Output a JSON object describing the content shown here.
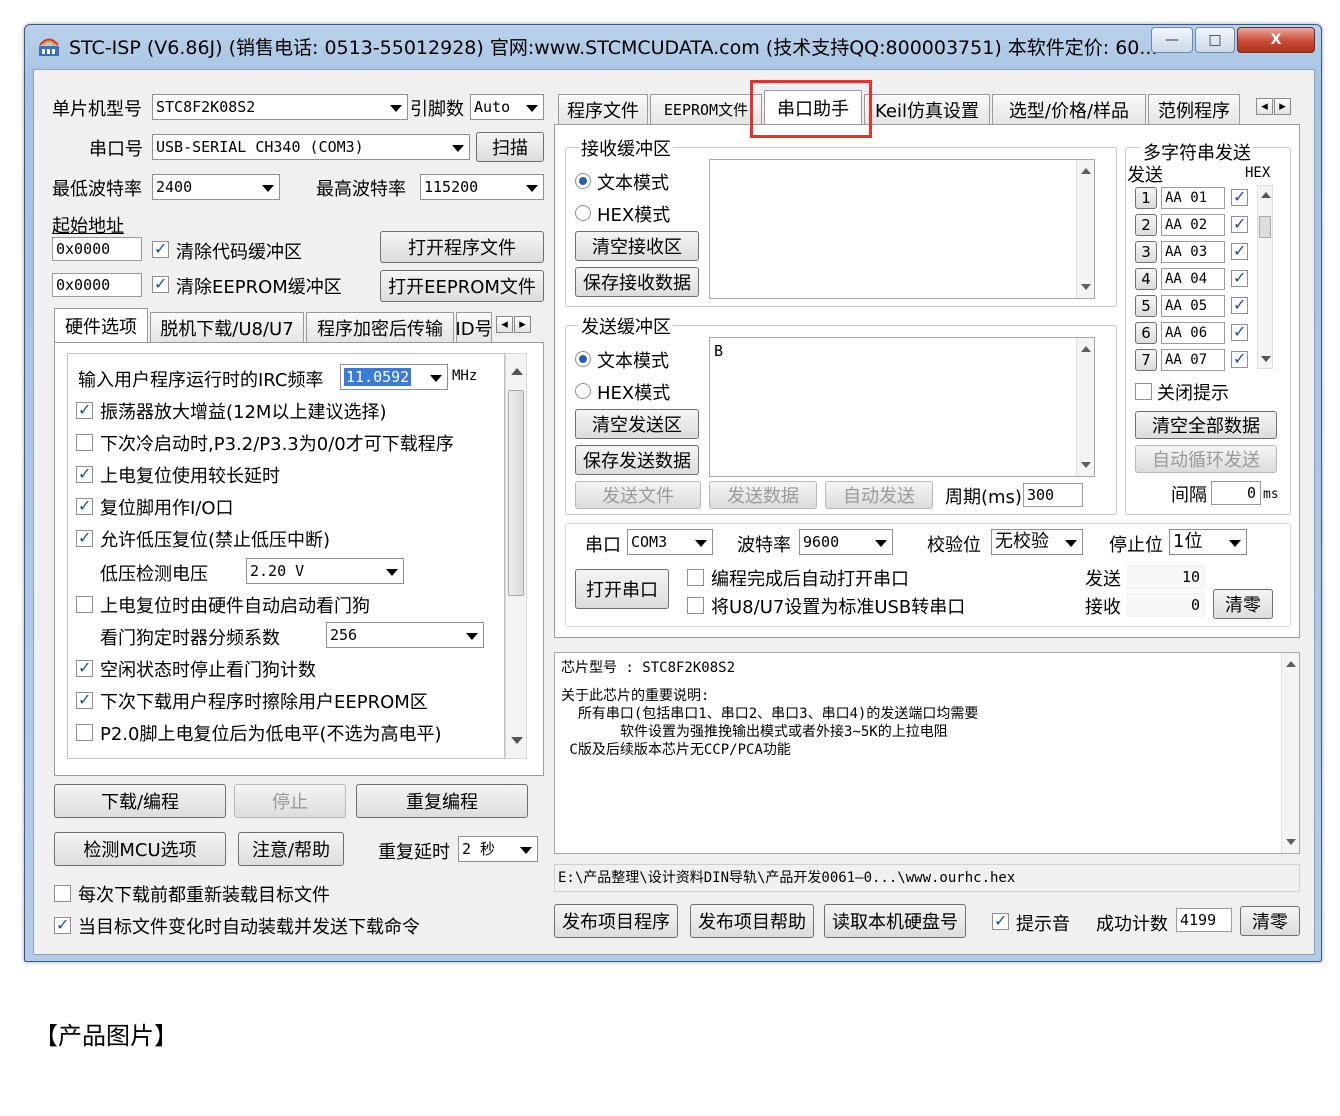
{
  "window": {
    "title": "STC-ISP (V6.86J) (销售电话: 0513-55012928) 官网:www.STCMCUDATA.com  (技术支持QQ:800003751) 本软件定价: 60...",
    "min_glyph": "—",
    "max_glyph": "□",
    "close_glyph": "X"
  },
  "left": {
    "mcu_type_label": "单片机型号",
    "mcu_type_value": "STC8F2K08S2",
    "pins_label": "引脚数",
    "pins_value": "Auto",
    "port_label": "串口号",
    "port_value": "USB-SERIAL CH340 (COM3)",
    "scan_button": "扫描",
    "min_baud_label": "最低波特率",
    "min_baud_value": "2400",
    "max_baud_label": "最高波特率",
    "max_baud_value": "115200",
    "start_addr_label": "起始地址",
    "addr1": "0x0000",
    "clear_code_label": "清除代码缓冲区",
    "open_prog_button": "打开程序文件",
    "addr2": "0x0000",
    "clear_eeprom_label": "清除EEPROM缓冲区",
    "open_eeprom_button": "打开EEPROM文件",
    "tabs": [
      "硬件选项",
      "脱机下载/U8/U7",
      "程序加密后传输",
      "ID号"
    ],
    "options": {
      "irc_label": "输入用户程序运行时的IRC频率",
      "irc_value": "11.0592",
      "irc_unit": "MHz",
      "items": [
        {
          "label": "振荡器放大增益(12M以上建议选择)",
          "checked": true
        },
        {
          "label": "下次冷启动时,P3.2/P3.3为0/0才可下载程序",
          "checked": false
        },
        {
          "label": "上电复位使用较长延时",
          "checked": true
        },
        {
          "label": "复位脚用作I/O口",
          "checked": true
        },
        {
          "label": "允许低压复位(禁止低压中断)",
          "checked": true
        }
      ],
      "lv_label": "低压检测电压",
      "lv_value": "2.20 V",
      "wdt_item": {
        "label": "上电复位时由硬件自动启动看门狗",
        "checked": false
      },
      "wdt_div_label": "看门狗定时器分频系数",
      "wdt_div_value": "256",
      "items2": [
        {
          "label": "空闲状态时停止看门狗计数",
          "checked": true
        },
        {
          "label": "下次下载用户程序时擦除用户EEPROM区",
          "checked": true
        },
        {
          "label": "P2.0脚上电复位后为低电平(不选为高电平)",
          "checked": false
        }
      ]
    },
    "download_button": "下载/编程",
    "stop_button": "停止",
    "reprogram_button": "重复编程",
    "detect_button": "检测MCU选项",
    "help_button": "注意/帮助",
    "repeat_delay_label": "重复延时",
    "repeat_delay_value": "2 秒",
    "reload_label": "每次下载前都重新装载目标文件",
    "reload_checked": false,
    "autosend_label": "当目标文件变化时自动装载并发送下载命令",
    "autosend_checked": true
  },
  "right": {
    "tabs": [
      "程序文件",
      "EEPROM文件",
      "串口助手",
      "Keil仿真设置",
      "选型/价格/样品",
      "范例程序"
    ],
    "active_tab": "串口助手",
    "highlight_color": "#e8312a",
    "recv": {
      "title": "接收缓冲区",
      "text_mode": "文本模式",
      "hex_mode": "HEX模式",
      "clear_button": "清空接收区",
      "save_button": "保存接收数据"
    },
    "send": {
      "title": "发送缓冲区",
      "text_mode": "文本模式",
      "hex_mode": "HEX模式",
      "clear_button": "清空发送区",
      "save_button": "保存发送数据",
      "content": "B",
      "send_file": "发送文件",
      "send_data": "发送数据",
      "auto_send": "自动发送",
      "period_label": "周期(ms)",
      "period_value": "300"
    },
    "multi": {
      "title": "多字符串发送",
      "send_col": "发送",
      "hex_col": "HEX",
      "rows": [
        {
          "n": "1",
          "v": "AA 01"
        },
        {
          "n": "2",
          "v": "AA 02"
        },
        {
          "n": "3",
          "v": "AA 03"
        },
        {
          "n": "4",
          "v": "AA 04"
        },
        {
          "n": "5",
          "v": "AA 05"
        },
        {
          "n": "6",
          "v": "AA 06"
        },
        {
          "n": "7",
          "v": "AA 07"
        }
      ],
      "close_tip": "关闭提示",
      "clear_all": "清空全部数据",
      "auto_loop": "自动循环发送",
      "interval_label": "间隔",
      "interval_value": "0",
      "interval_unit": "ms"
    },
    "serial": {
      "port_label": "串口",
      "port_value": "COM3",
      "baud_label": "波特率",
      "baud_value": "9600",
      "parity_label": "校验位",
      "parity_value": "无校验",
      "stop_label": "停止位",
      "stop_value": "1位",
      "open_button": "打开串口",
      "auto_open_label": "编程完成后自动打开串口",
      "usb_label": "将U8/U7设置为标准USB转串口",
      "sent_label": "发送",
      "sent_value": "10",
      "recv_label": "接收",
      "recv_value": "0",
      "clear_button": "清零"
    },
    "info": {
      "line1": "芯片型号 : STC8F2K08S2",
      "line2": "关于此芯片的重要说明:",
      "line3": "  所有串口(包括串口1、串口2、串口3、串口4)的发送端口均需要",
      "line4": "       软件设置为强推挽输出模式或者外接3~5K的上拉电阻",
      "line5": " C版及后续版本芯片无CCP/PCA功能"
    },
    "path": "E:\\产品整理\\设计资料DIN导轨\\产品开发0061—0...\\www.ourhc.hex",
    "publish_prog": "发布项目程序",
    "publish_help": "发布项目帮助",
    "read_disk": "读取本机硬盘号",
    "beep_label": "提示音",
    "success_label": "成功计数",
    "success_value": "4199",
    "clear_button": "清零"
  },
  "caption": "【产品图片】"
}
